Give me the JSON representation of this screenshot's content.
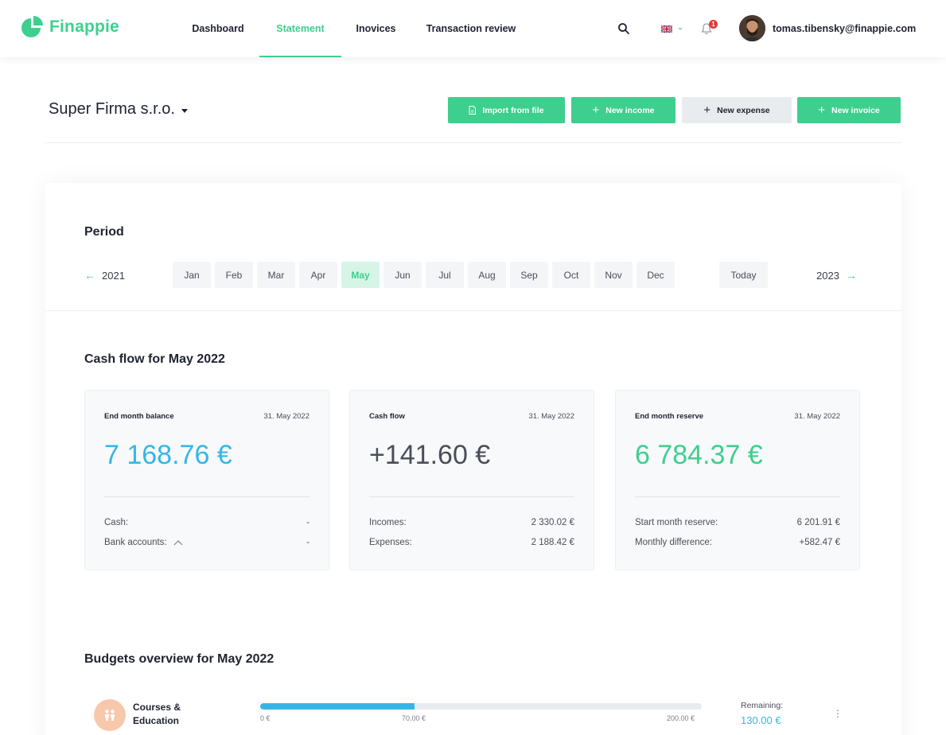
{
  "app": {
    "name": "Finappie"
  },
  "nav": {
    "items": [
      {
        "label": "Dashboard",
        "active": false
      },
      {
        "label": "Statement",
        "active": true
      },
      {
        "label": "Inovices",
        "active": false
      },
      {
        "label": "Transaction review",
        "active": false
      }
    ]
  },
  "header": {
    "search_icon": "search-icon",
    "language_icon": "uk-flag-icon",
    "notification_icon": "bell-icon",
    "notification_count": "1",
    "user_email": "tomas.tibensky@finappie.com"
  },
  "company": {
    "name": "Super Firma s.r.o."
  },
  "actions": {
    "import_label": "Import from file",
    "new_income_label": "New income",
    "new_expense_label": "New expense",
    "new_invoice_label": "New invoice"
  },
  "period": {
    "title": "Period",
    "prev_year": "2021",
    "next_year": "2023",
    "months": [
      "Jan",
      "Feb",
      "Mar",
      "Apr",
      "May",
      "Jun",
      "Jul",
      "Aug",
      "Sep",
      "Oct",
      "Nov",
      "Dec"
    ],
    "active_month": "May",
    "today_label": "Today"
  },
  "cashflow": {
    "title": "Cash flow for May 2022",
    "balance": {
      "label": "End month balance",
      "date": "31. May 2022",
      "value": "7 168.76 €",
      "color": "#36b6e6",
      "rows": [
        {
          "label": "Cash:",
          "value": "-"
        },
        {
          "label": "Bank accounts:",
          "value": "-"
        }
      ]
    },
    "flow": {
      "label": "Cash flow",
      "date": "31. May 2022",
      "value": "+141.60 €",
      "color": "#4a4e5a",
      "rows": [
        {
          "label": "Incomes:",
          "value": "2 330.02 €"
        },
        {
          "label": "Expenses:",
          "value": "2 188.42 €"
        }
      ]
    },
    "reserve": {
      "label": "End month reserve",
      "date": "31. May 2022",
      "value": "6 784.37 €",
      "color": "#3ecf8e",
      "rows": [
        {
          "label": "Start month reserve:",
          "value": "6 201.91 €"
        },
        {
          "label": "Monthly difference:",
          "value": "+582.47 €"
        }
      ]
    }
  },
  "budgets": {
    "title": "Budgets overview for May 2022",
    "items": [
      {
        "name": "Courses & Education",
        "icon": "people-icon",
        "spent_fraction": 0.35,
        "tick_min": "0 €",
        "tick_spent": "70.00 €",
        "tick_max": "200.00 €",
        "remaining_label": "Remaining:",
        "remaining_value": "130.00 €"
      }
    ]
  },
  "colors": {
    "brand_green": "#3ecf8e",
    "balance_blue": "#36b6e6",
    "badge_red": "#e53935"
  }
}
